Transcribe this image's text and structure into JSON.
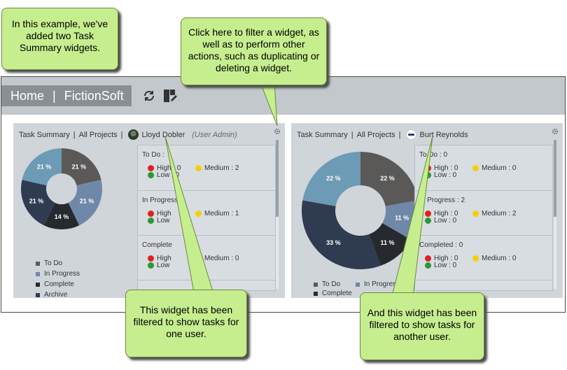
{
  "callouts": {
    "intro": "In this example, we've added two Task Summary widgets.",
    "filter": "Click here to filter a widget, as well as to perform other actions, such as duplicating or deleting a widget.",
    "one_user": "This widget has been filtered to show tasks for one user.",
    "another_user": "And this widget has been filtered to show tasks for another user."
  },
  "topbar": {
    "home": "Home",
    "separator": "|",
    "org": "FictionSoft",
    "refresh_icon": "refresh-icon",
    "edit_icon": "edit-layout-icon"
  },
  "colors": {
    "todo": "#5b5957",
    "in_progress": "#7088a8",
    "complete": "#262a2e",
    "archive": "#2f3b50",
    "fifth": "#6d9ab4",
    "high": "#e02020",
    "low": "#2a9a30",
    "medium": "#f5d000"
  },
  "widgets": [
    {
      "title": "Task Summary",
      "sep": "|",
      "project": "All Projects",
      "user": "Lloyd Dobler",
      "role": "(User Admin)",
      "chart_data": {
        "type": "pie",
        "title": "",
        "labels": [
          "To Do",
          "In Progress",
          "Complete",
          "Archive",
          ""
        ],
        "values": [
          21,
          21,
          14,
          21,
          21
        ]
      },
      "legend": [
        "To Do",
        "In Progress",
        "Complete",
        "Archive"
      ],
      "statuses": [
        {
          "title": "To Do : ",
          "high": "High : 0",
          "low": "Low : 0",
          "medium": "Medium : 2"
        },
        {
          "title": "In Progress",
          "high": "High",
          "low": "Low",
          "medium": "Medium : 1"
        },
        {
          "title": "Complete",
          "high": "High",
          "low": "Low",
          "medium": "Medium : 0"
        }
      ]
    },
    {
      "title": "Task Summary",
      "sep": "|",
      "project": "All Projects",
      "user": "Burt Reynolds",
      "chart_data": {
        "type": "pie",
        "title": "",
        "labels": [
          "To Do",
          "In Progress",
          "Complete",
          "Archive",
          ""
        ],
        "values": [
          22,
          11,
          11,
          33,
          22
        ]
      },
      "legend": [
        "To Do",
        "In Progress",
        "Complete"
      ],
      "statuses": [
        {
          "title": "To Do : 0",
          "high": "High : 0",
          "low": "Low : 0",
          "medium": "Medium : 0"
        },
        {
          "title": "In Progress : 2",
          "high": "High : 0",
          "low": "Low : 0",
          "medium": "Medium : 2"
        },
        {
          "title": "Completed : 0",
          "high": "High : 0",
          "low": "Low : 0",
          "medium": "Medium : 0"
        }
      ]
    }
  ]
}
